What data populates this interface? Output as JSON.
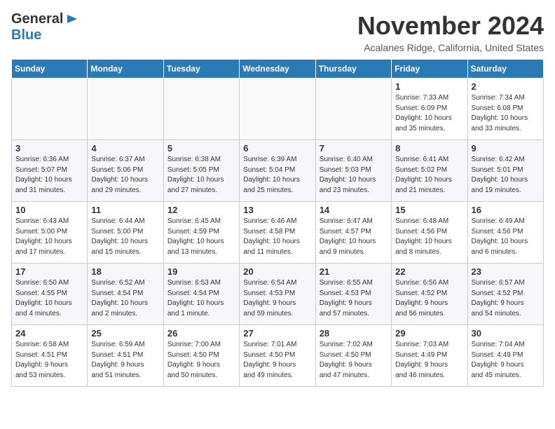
{
  "header": {
    "logo_general": "General",
    "logo_blue": "Blue",
    "month": "November 2024",
    "location": "Acalanes Ridge, California, United States"
  },
  "weekdays": [
    "Sunday",
    "Monday",
    "Tuesday",
    "Wednesday",
    "Thursday",
    "Friday",
    "Saturday"
  ],
  "weeks": [
    [
      {
        "day": "",
        "info": ""
      },
      {
        "day": "",
        "info": ""
      },
      {
        "day": "",
        "info": ""
      },
      {
        "day": "",
        "info": ""
      },
      {
        "day": "",
        "info": ""
      },
      {
        "day": "1",
        "info": "Sunrise: 7:33 AM\nSunset: 6:09 PM\nDaylight: 10 hours\nand 35 minutes."
      },
      {
        "day": "2",
        "info": "Sunrise: 7:34 AM\nSunset: 6:08 PM\nDaylight: 10 hours\nand 33 minutes."
      }
    ],
    [
      {
        "day": "3",
        "info": "Sunrise: 6:36 AM\nSunset: 5:07 PM\nDaylight: 10 hours\nand 31 minutes."
      },
      {
        "day": "4",
        "info": "Sunrise: 6:37 AM\nSunset: 5:06 PM\nDaylight: 10 hours\nand 29 minutes."
      },
      {
        "day": "5",
        "info": "Sunrise: 6:38 AM\nSunset: 5:05 PM\nDaylight: 10 hours\nand 27 minutes."
      },
      {
        "day": "6",
        "info": "Sunrise: 6:39 AM\nSunset: 5:04 PM\nDaylight: 10 hours\nand 25 minutes."
      },
      {
        "day": "7",
        "info": "Sunrise: 6:40 AM\nSunset: 5:03 PM\nDaylight: 10 hours\nand 23 minutes."
      },
      {
        "day": "8",
        "info": "Sunrise: 6:41 AM\nSunset: 5:02 PM\nDaylight: 10 hours\nand 21 minutes."
      },
      {
        "day": "9",
        "info": "Sunrise: 6:42 AM\nSunset: 5:01 PM\nDaylight: 10 hours\nand 19 minutes."
      }
    ],
    [
      {
        "day": "10",
        "info": "Sunrise: 6:43 AM\nSunset: 5:00 PM\nDaylight: 10 hours\nand 17 minutes."
      },
      {
        "day": "11",
        "info": "Sunrise: 6:44 AM\nSunset: 5:00 PM\nDaylight: 10 hours\nand 15 minutes."
      },
      {
        "day": "12",
        "info": "Sunrise: 6:45 AM\nSunset: 4:59 PM\nDaylight: 10 hours\nand 13 minutes."
      },
      {
        "day": "13",
        "info": "Sunrise: 6:46 AM\nSunset: 4:58 PM\nDaylight: 10 hours\nand 11 minutes."
      },
      {
        "day": "14",
        "info": "Sunrise: 6:47 AM\nSunset: 4:57 PM\nDaylight: 10 hours\nand 9 minutes."
      },
      {
        "day": "15",
        "info": "Sunrise: 6:48 AM\nSunset: 4:56 PM\nDaylight: 10 hours\nand 8 minutes."
      },
      {
        "day": "16",
        "info": "Sunrise: 6:49 AM\nSunset: 4:56 PM\nDaylight: 10 hours\nand 6 minutes."
      }
    ],
    [
      {
        "day": "17",
        "info": "Sunrise: 6:50 AM\nSunset: 4:55 PM\nDaylight: 10 hours\nand 4 minutes."
      },
      {
        "day": "18",
        "info": "Sunrise: 6:52 AM\nSunset: 4:54 PM\nDaylight: 10 hours\nand 2 minutes."
      },
      {
        "day": "19",
        "info": "Sunrise: 6:53 AM\nSunset: 4:54 PM\nDaylight: 10 hours\nand 1 minute."
      },
      {
        "day": "20",
        "info": "Sunrise: 6:54 AM\nSunset: 4:53 PM\nDaylight: 9 hours\nand 59 minutes."
      },
      {
        "day": "21",
        "info": "Sunrise: 6:55 AM\nSunset: 4:53 PM\nDaylight: 9 hours\nand 57 minutes."
      },
      {
        "day": "22",
        "info": "Sunrise: 6:56 AM\nSunset: 4:52 PM\nDaylight: 9 hours\nand 56 minutes."
      },
      {
        "day": "23",
        "info": "Sunrise: 6:57 AM\nSunset: 4:52 PM\nDaylight: 9 hours\nand 54 minutes."
      }
    ],
    [
      {
        "day": "24",
        "info": "Sunrise: 6:58 AM\nSunset: 4:51 PM\nDaylight: 9 hours\nand 53 minutes."
      },
      {
        "day": "25",
        "info": "Sunrise: 6:59 AM\nSunset: 4:51 PM\nDaylight: 9 hours\nand 51 minutes."
      },
      {
        "day": "26",
        "info": "Sunrise: 7:00 AM\nSunset: 4:50 PM\nDaylight: 9 hours\nand 50 minutes."
      },
      {
        "day": "27",
        "info": "Sunrise: 7:01 AM\nSunset: 4:50 PM\nDaylight: 9 hours\nand 49 minutes."
      },
      {
        "day": "28",
        "info": "Sunrise: 7:02 AM\nSunset: 4:50 PM\nDaylight: 9 hours\nand 47 minutes."
      },
      {
        "day": "29",
        "info": "Sunrise: 7:03 AM\nSunset: 4:49 PM\nDaylight: 9 hours\nand 46 minutes."
      },
      {
        "day": "30",
        "info": "Sunrise: 7:04 AM\nSunset: 4:49 PM\nDaylight: 9 hours\nand 45 minutes."
      }
    ]
  ]
}
